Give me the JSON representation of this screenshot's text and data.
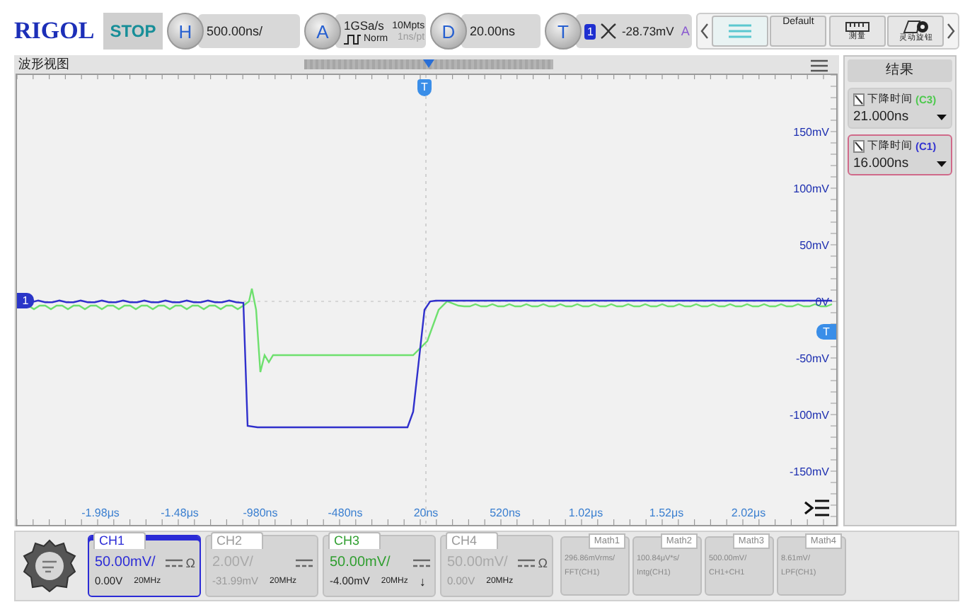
{
  "top_bar": {
    "logo": "RIGOL",
    "run_state": "STOP",
    "horizontal": {
      "key": "H",
      "value": "500.00ns/"
    },
    "acquisition": {
      "key": "A",
      "sample_rate": "1GSa/s",
      "mode": "Norm",
      "memory_depth": "10Mpts",
      "resolution": "1ns/pt"
    },
    "delay": {
      "key": "D",
      "value": "20.00ns"
    },
    "trigger": {
      "key": "T",
      "source": "1",
      "level": "-28.73mV",
      "sweep": "A"
    },
    "toolbar": [
      {
        "kind": "layers"
      },
      {
        "kind": "text",
        "label": "Default"
      },
      {
        "kind": "ruler",
        "label": "测量"
      },
      {
        "kind": "knob",
        "label": "灵动旋钮"
      }
    ]
  },
  "waveform": {
    "title": "波形视图",
    "channel_marker": "1",
    "trigger_level_marker": "T",
    "trigger_position_marker": "T",
    "y_labels": [
      "150mV",
      "100mV",
      "50mV",
      "0V",
      "-50mV",
      "-100mV",
      "-150mV"
    ],
    "x_labels": [
      "-1.98μs",
      "-1.48μs",
      "-980ns",
      "-480ns",
      "20ns",
      "520ns",
      "1.02μs",
      "1.52μs",
      "2.02μs"
    ]
  },
  "results": {
    "title": "结果",
    "items": [
      {
        "name": "下降时间",
        "source": "(C3)",
        "color": "#4ec94e",
        "value": "21.000ns",
        "selected": false
      },
      {
        "name": "下降时间",
        "source": "(C1)",
        "color": "#3434d0",
        "value": "16.000ns",
        "selected": true
      }
    ]
  },
  "channels": [
    {
      "label": "CH1",
      "scale": "50.00mV/",
      "offset": "0.00V",
      "bandwidth": "20MHz",
      "impedance": "Ω",
      "on": true,
      "selected": true,
      "color": "#2b2bd6"
    },
    {
      "label": "CH2",
      "scale": "2.00V/",
      "offset": "-31.99mV",
      "bandwidth": "20MHz",
      "on": false,
      "selected": false
    },
    {
      "label": "CH3",
      "scale": "50.00mV/",
      "offset": "-4.00mV",
      "bandwidth": "20MHz",
      "invert_marker": "↓",
      "on": true,
      "selected": false,
      "color": "#2f9e2f"
    },
    {
      "label": "CH4",
      "scale": "50.00mV/",
      "offset": "0.00V",
      "bandwidth": "20MHz",
      "impedance": "Ω",
      "on": false,
      "selected": false
    }
  ],
  "math": [
    {
      "label": "Math1",
      "scale": "296.86mVrms/",
      "function": "FFT(CH1)"
    },
    {
      "label": "Math2",
      "scale": "100.84μV*s/",
      "function": "Intg(CH1)"
    },
    {
      "label": "Math3",
      "scale": "500.00mV/",
      "function": "CH1+CH1"
    },
    {
      "label": "Math4",
      "scale": "8.61mV/",
      "function": "LPF(CH1)"
    }
  ]
}
